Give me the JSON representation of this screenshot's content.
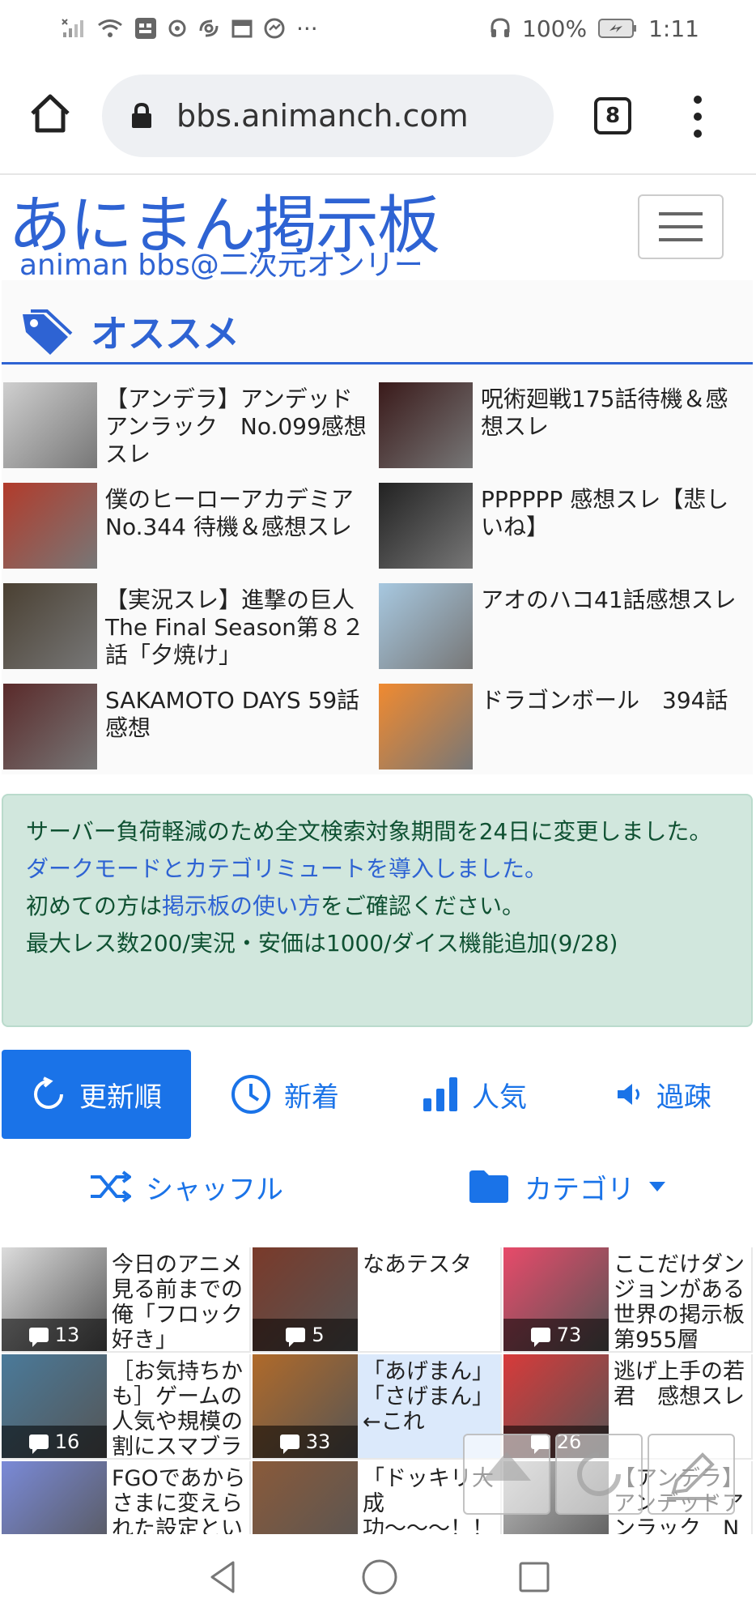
{
  "status": {
    "left_icons": [
      "signal-off-icon",
      "wifi-icon",
      "carrier-icon",
      "record-icon",
      "hurricane-icon",
      "calendar-icon",
      "chat-icon"
    ],
    "more": "···",
    "battery": "100%",
    "time": "1:11"
  },
  "browser": {
    "url": "bbs.animanch.com",
    "tab_count": "8"
  },
  "site": {
    "logo_main": "あにまん掲示板",
    "logo_sub": "animan bbs@二次元オンリー"
  },
  "recommend": {
    "title": "オススメ",
    "items": [
      {
        "text": "【アンデラ】アンデッドアンラック　No.099感想スレ",
        "thumb_color": "#cfcfcf"
      },
      {
        "text": "呪術廻戦175話待機＆感想スレ",
        "thumb_color": "#3a1a1a"
      },
      {
        "text": "僕のヒーローアカデミア　No.344 待機＆感想スレ",
        "thumb_color": "#b23b2b"
      },
      {
        "text": "PPPPPP 感想スレ【悲しいね】",
        "thumb_color": "#222222"
      },
      {
        "text": "【実況スレ】進撃の巨人 The Final Season第８２話「夕焼け」",
        "thumb_color": "#4a4032"
      },
      {
        "text": "アオのハコ41話感想スレ",
        "thumb_color": "#a7c8e0"
      },
      {
        "text": "SAKAMOTO DAYS 59話感想",
        "thumb_color": "#5a2a2a"
      },
      {
        "text": "ドラゴンボール　394話",
        "thumb_color": "#f08a30"
      }
    ]
  },
  "notice": {
    "line1": "サーバー負荷軽減のため全文検索対象期間を24日に変更しました。",
    "line2_link": "ダークモードとカテゴリミュートを導入しました。",
    "line3_pre": "初めての方は",
    "line3_link": "掲示板の使い方",
    "line3_post": "をご確認ください。",
    "line4": "最大レス数200/実況・安価は1000/ダイス機能追加(9/28)"
  },
  "sort_tabs": [
    {
      "label": "更新順",
      "icon": "refresh-icon",
      "active": true
    },
    {
      "label": "新着",
      "icon": "clock-icon"
    },
    {
      "label": "人気",
      "icon": "bar-chart-icon"
    },
    {
      "label": "過疎",
      "icon": "speaker-icon"
    }
  ],
  "sub_tabs": [
    {
      "label": "シャッフル",
      "icon": "shuffle-icon"
    },
    {
      "label": "カテゴリ",
      "icon": "folder-icon"
    }
  ],
  "threads": [
    {
      "title": "今日のアニメ見る前までの俺「フロック好き」",
      "count": "13",
      "thumb_color": "#dcdcdc"
    },
    {
      "title": "なあテスタ",
      "count": "5",
      "thumb_color": "#7a3a2a"
    },
    {
      "title": "ここだけダンジョンがある世界の掲示板第955層",
      "count": "73",
      "thumb_color": "#e84a6a"
    },
    {
      "title": "［お気持ちかも］ゲームの人気や規模の割にスマブラ",
      "count": "16",
      "thumb_color": "#4a7a9a"
    },
    {
      "title": "「あげまん」「さげまん」←これ",
      "count": "33",
      "thumb_color": "#b06a2a"
    },
    {
      "title": "逃げ上手の若君　感想スレ",
      "count": "26",
      "thumb_color": "#d83a3a"
    },
    {
      "title": "FGOであからさまに変えられた設定とい",
      "count": "",
      "thumb_color": "#7a8ad8"
    },
    {
      "title": "「ドッキリ大成功〜〜〜！！",
      "count": "",
      "thumb_color": "#8a5a3a"
    },
    {
      "title": "【アンデラ】アンデッドアンラック　N",
      "count": "",
      "thumb_color": "#bcbcbc"
    }
  ]
}
